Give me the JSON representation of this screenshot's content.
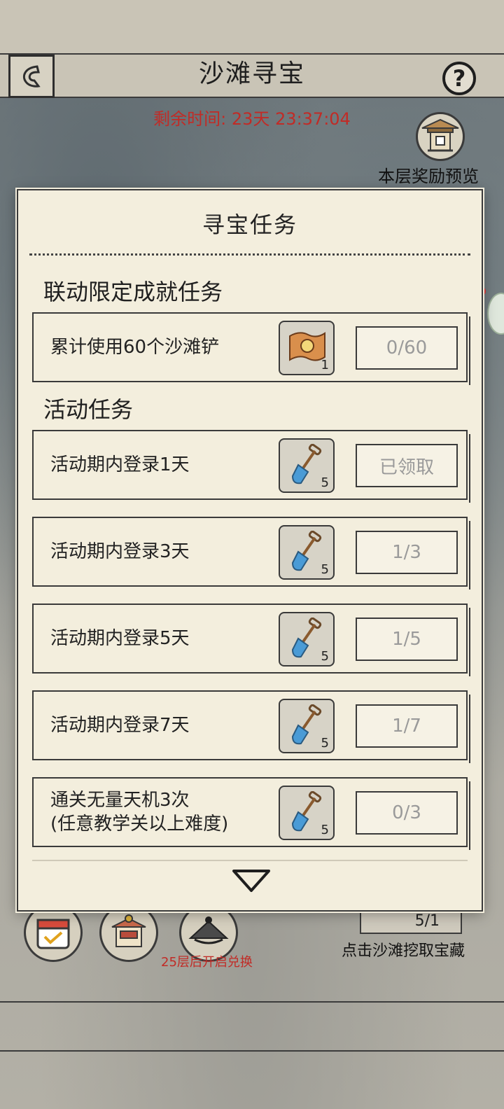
{
  "header": {
    "title": "沙滩寻宝",
    "back_icon": "back-arrow-icon",
    "help_label": "?",
    "timer": "剩余时间: 23天 23:37:04",
    "reward_preview_label": "本层奖励预览"
  },
  "modal": {
    "title": "寻宝任务",
    "sections": [
      {
        "title": "联动限定成就任务"
      },
      {
        "title": "活动任务"
      }
    ],
    "achievement_task": {
      "text": "累计使用60个沙滩铲",
      "reward_icon": "treasure-map-icon",
      "reward_qty": "1",
      "progress": "0/60"
    },
    "activity_tasks": [
      {
        "text": "活动期内登录1天",
        "reward_icon": "shovel-icon",
        "reward_qty": "5",
        "progress": "已领取"
      },
      {
        "text": "活动期内登录3天",
        "reward_icon": "shovel-icon",
        "reward_qty": "5",
        "progress": "1/3"
      },
      {
        "text": "活动期内登录5天",
        "reward_icon": "shovel-icon",
        "reward_qty": "5",
        "progress": "1/5"
      },
      {
        "text": "活动期内登录7天",
        "reward_icon": "shovel-icon",
        "reward_qty": "5",
        "progress": "1/7"
      },
      {
        "text_line1": "通关无量天机3次",
        "text_line2": "(任意教学关以上难度)",
        "reward_icon": "shovel-icon",
        "reward_qty": "5",
        "progress": "0/3"
      }
    ]
  },
  "bottom": {
    "exchange_note": "25层后开启兑换",
    "shovel_count": "5/1",
    "dig_hint": "点击沙滩挖取宝藏"
  },
  "colors": {
    "panel": "#f3eedd",
    "timer_red": "#c12b26",
    "progress_gray": "#9a9a9a",
    "shovel_blue": "#4a9bd6"
  }
}
